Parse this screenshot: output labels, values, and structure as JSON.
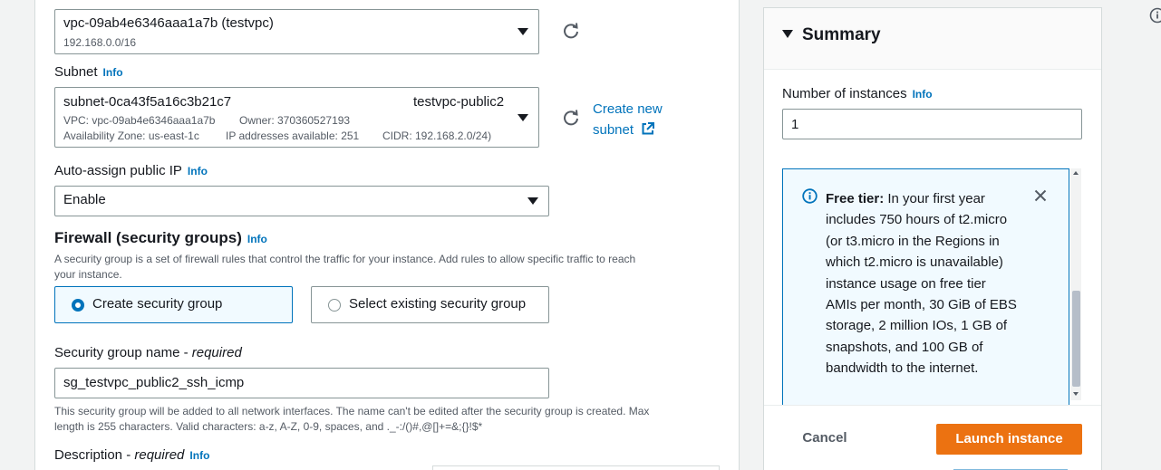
{
  "vpc": {
    "selected": "vpc-09ab4e6346aaa1a7b (testvpc)",
    "cidr": "192.168.0.0/16"
  },
  "subnet": {
    "label": "Subnet",
    "info": "Info",
    "id": "subnet-0ca43f5a16c3b21c7",
    "name": "testvpc-public2",
    "vpc": "VPC: vpc-09ab4e6346aaa1a7b",
    "owner": "Owner: 370360527193",
    "az": "Availability Zone: us-east-1c",
    "ips": "IP addresses available: 251",
    "cidr": "CIDR: 192.168.2.0/24)",
    "create_new_1": "Create new",
    "create_new_2": "subnet"
  },
  "auto_ip": {
    "label": "Auto-assign public IP",
    "info": "Info",
    "value": "Enable"
  },
  "firewall": {
    "title": "Firewall (security groups)",
    "info": "Info",
    "desc_1": "A security group is a set of firewall rules that control the traffic for your instance. Add rules to allow specific traffic to reach",
    "desc_2": "your instance.",
    "option_create": "Create security group",
    "option_existing": "Select existing security group"
  },
  "sg_name": {
    "label": "Security group name - ",
    "required": "required",
    "value": "sg_testvpc_public2_ssh_icmp",
    "help_1": "This security group will be added to all network interfaces. The name can't be edited after the security group is created. Max",
    "help_2": "length is 255 characters. Valid characters: a-z, A-Z, 0-9, spaces, and ._-:/()#,@[]+=&;{}!$*"
  },
  "description": {
    "label": "Description - ",
    "required": "required",
    "info": "Info"
  },
  "summary": {
    "title": "Summary",
    "instances_label": "Number of instances",
    "info": "Info",
    "instances_value": "1",
    "free_tier_bold": "Free tier:",
    "free_tier_lines": [
      "In your first year",
      "includes 750 hours of t2.micro",
      "(or t3.micro in the Regions in",
      "which t2.micro is unavailable)",
      "instance usage on free tier",
      "AMIs per month, 30 GiB of EBS",
      "storage, 2 million IOs, 1 GB of",
      "snapshots, and 100 GB of",
      "bandwidth to the internet."
    ],
    "cancel": "Cancel",
    "launch": "Launch instance"
  },
  "colors": {
    "accent": "#0073bb",
    "launch": "#ec7211"
  }
}
